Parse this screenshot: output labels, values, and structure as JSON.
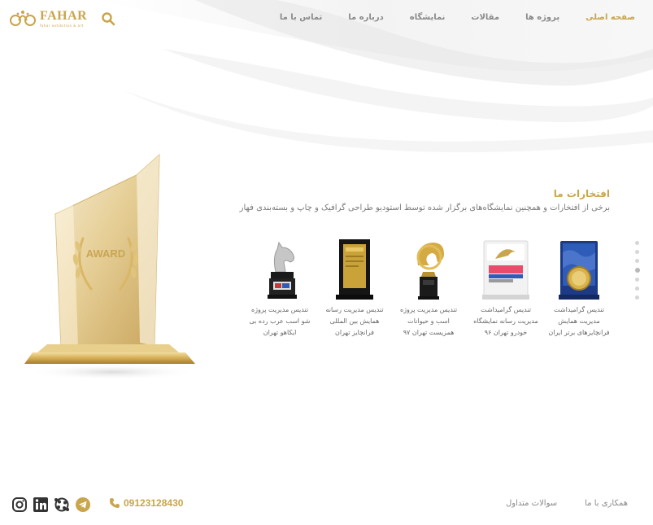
{
  "brand": {
    "name": "FAHAR",
    "tagline": "fahar exhibition & art"
  },
  "nav": [
    {
      "label": "صفحه اصلی",
      "active": true
    },
    {
      "label": "پروژه ها",
      "active": false
    },
    {
      "label": "مقالات",
      "active": false
    },
    {
      "label": "نمایشگاه",
      "active": false
    },
    {
      "label": "درباره ما",
      "active": false
    },
    {
      "label": "تماس با ما",
      "active": false
    }
  ],
  "hero": {
    "award_text": "AWARD"
  },
  "section": {
    "title": "افتخارات ما",
    "description": "برخی از افتخارات و همچنین نمایشگاه‌های برگزار شده توسط استودیو طراحی گرافیک و چاپ و بسته‌بندی فهار"
  },
  "awards": [
    {
      "line1": "تندیس گرامیداشت",
      "line2": "مدیریت همایش",
      "line3": "فرانچایزهای برتر ایران"
    },
    {
      "line1": "تندیس گرامیداشت",
      "line2": "مدیریت رسانه نمایشگاه",
      "line3": "خودرو تهران ۹۶"
    },
    {
      "line1": "تندیس مدیریت پروژه",
      "line2": "اسب و حیوانات",
      "line3": "همزیست تهران ۹۷"
    },
    {
      "line1": "تندیس مدیریت رسانه",
      "line2": "همایش بین المللی",
      "line3": "فرانچایز تهران"
    },
    {
      "line1": "تندیس مدیریت پروژه",
      "line2": "شو اسب عرب رده بی",
      "line3": "ایکاهو تهران"
    }
  ],
  "slider": {
    "count": 7,
    "active_index": 3
  },
  "footer": {
    "phone": "09123128430",
    "links": [
      "همکاری با ما",
      "سوالات متداول"
    ],
    "socials": [
      "instagram-icon",
      "linkedin-icon",
      "aparat-icon",
      "telegram-icon"
    ]
  },
  "colors": {
    "accent": "#c9a54b",
    "text_muted": "#8a8a8a"
  }
}
